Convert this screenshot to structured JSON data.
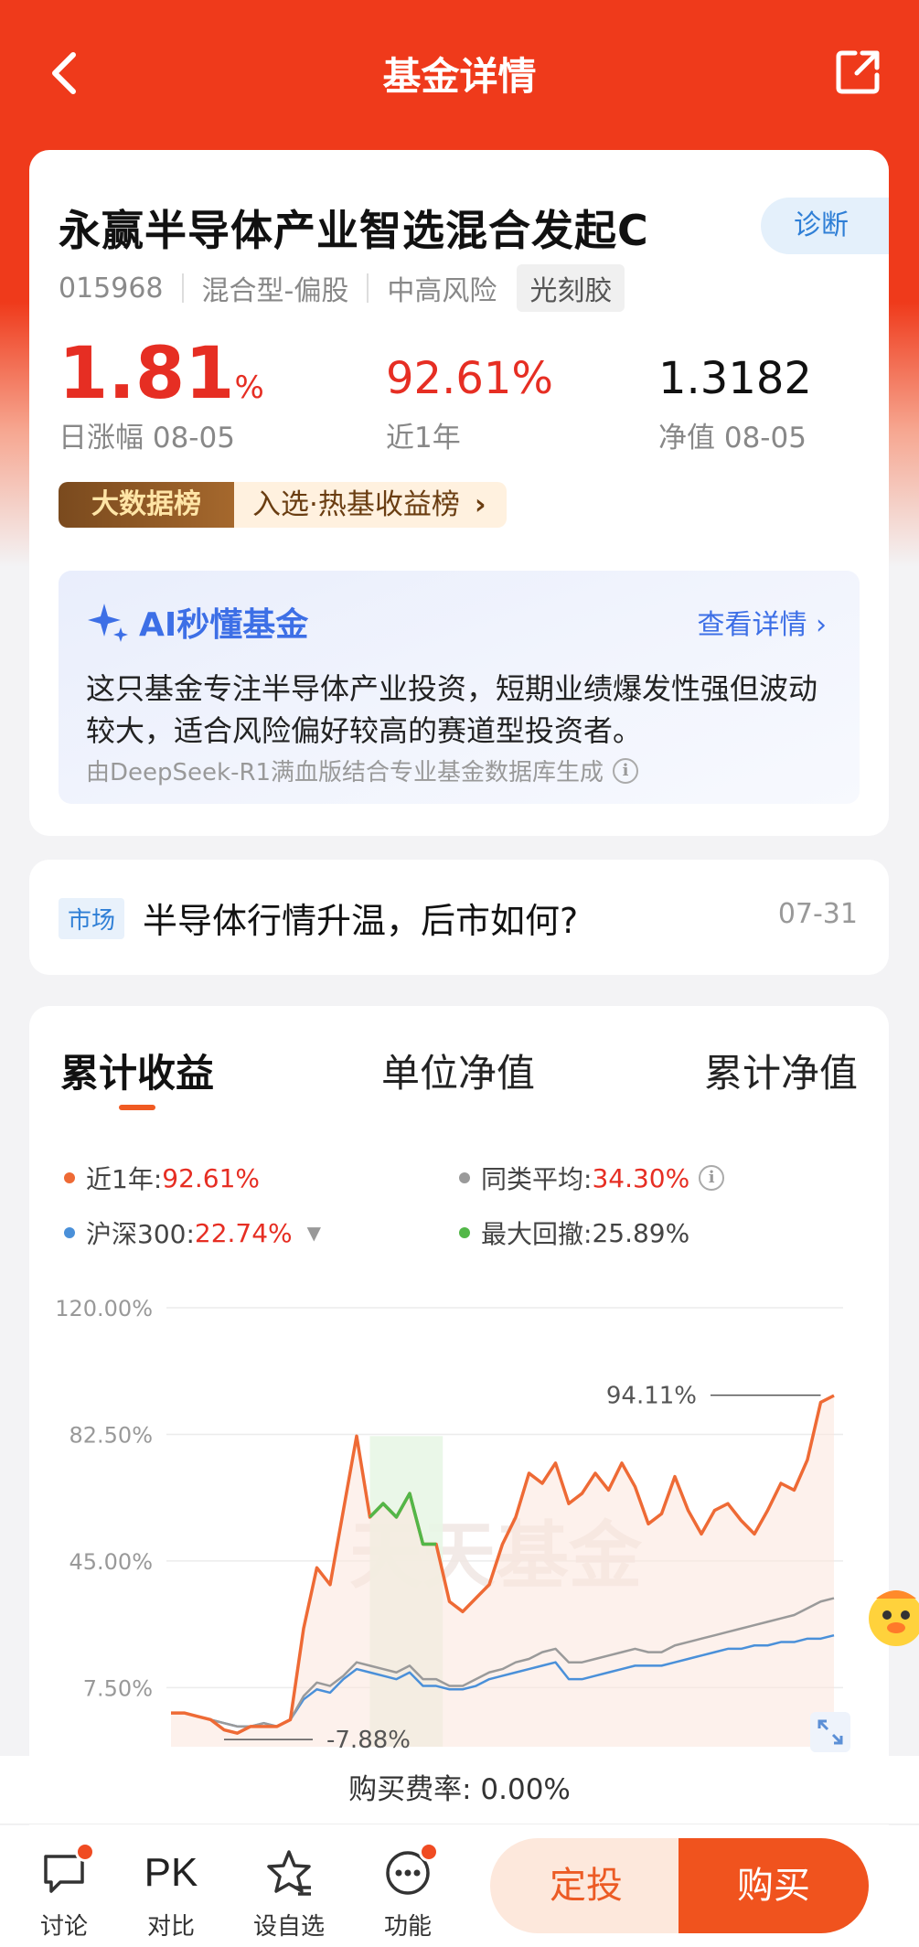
{
  "nav": {
    "title": "基金详情",
    "back_icon": "chevron-left-icon",
    "share_icon": "share-icon"
  },
  "fund": {
    "name": "永赢半导体产业智选混合发起C",
    "diagnose": "诊断",
    "code": "015968",
    "type": "混合型-偏股",
    "risk": "中高风险",
    "theme_tag": "光刻胶"
  },
  "stats": {
    "daily_value": "1.81",
    "daily_unit": "%",
    "daily_label": "日涨幅 08-05",
    "year_value": "92.61%",
    "year_label": "近1年",
    "nav_value": "1.3182",
    "nav_label": "净值 08-05"
  },
  "rank": {
    "badge": "大数据榜",
    "text": "入选·热基收益榜",
    "chevron": "›"
  },
  "ai": {
    "title": "AI秒懂基金",
    "more": "查看详情 ›",
    "desc": "这只基金专注半导体产业投资，短期业绩爆发性强但波动较大，适合风险偏好较高的赛道型投资者。",
    "footnote": "由DeepSeek-R1满血版结合专业基金数据库生成"
  },
  "news": {
    "tag": "市场",
    "title": "半导体行情升温，后市如何?",
    "date": "07-31"
  },
  "chart_tabs": {
    "tab1": "累计收益",
    "tab2": "单位净值",
    "tab3": "累计净值"
  },
  "legend": {
    "fund_label": "近1年:",
    "fund_value": "92.61%",
    "avg_label": "同类平均:",
    "avg_value": "34.30%",
    "index_label": "沪深300:",
    "index_value": "22.74%",
    "dd_label": "最大回撤:",
    "dd_value": "25.89%"
  },
  "colors": {
    "fund": "#ee6a35",
    "avg": "#9a9a9a",
    "index": "#4a90d9",
    "drawdown": "#52b748",
    "brand": "#ef3a1b"
  },
  "chart_data": {
    "type": "line",
    "ytick_labels": [
      "120.00%",
      "82.50%",
      "45.00%",
      "7.50%"
    ],
    "yticks": [
      120,
      82.5,
      45,
      7.5
    ],
    "ylim": [
      -7.88,
      120
    ],
    "watermark": "天天基金",
    "annotations": {
      "max_label": "94.11%",
      "max": 94.11,
      "min_label": "-7.88%",
      "min": -7.88
    },
    "x": [
      0,
      2,
      4,
      6,
      8,
      10,
      12,
      14,
      16,
      18,
      20,
      22,
      24,
      26,
      28,
      30,
      32,
      34,
      36,
      38,
      40,
      42,
      44,
      46,
      48,
      50,
      52,
      54,
      56,
      58,
      60,
      62,
      64,
      66,
      68,
      70,
      72,
      74,
      76,
      78,
      80,
      82,
      84,
      86,
      88,
      90,
      92,
      94,
      96,
      98,
      100
    ],
    "series": [
      {
        "name": "近1年",
        "values": [
          0,
          0,
          -1,
          -2,
          -5,
          -6,
          -4,
          -4,
          -4,
          -2,
          25,
          43,
          38,
          60,
          82,
          58,
          62,
          58,
          65,
          50,
          50,
          33,
          30,
          34,
          38,
          50,
          58,
          71,
          68,
          74,
          62,
          65,
          71,
          66,
          74,
          67,
          56,
          59,
          70,
          60,
          53,
          60,
          62,
          57,
          53,
          60,
          68,
          66,
          75,
          92,
          94
        ]
      },
      {
        "name": "同类平均",
        "values": [
          0,
          0,
          -1,
          -2,
          -3,
          -4,
          -4,
          -3,
          -4,
          -2,
          5,
          9,
          8,
          11,
          15,
          14,
          13,
          12,
          14,
          10,
          10,
          8,
          8,
          10,
          12,
          13,
          15,
          16,
          18,
          19,
          15,
          15,
          16,
          17,
          18,
          19,
          18,
          18,
          20,
          21,
          22,
          23,
          24,
          25,
          26,
          27,
          28,
          29,
          31,
          33,
          34
        ]
      },
      {
        "name": "沪深300",
        "values": [
          0,
          0,
          -1,
          -2,
          -3,
          -4,
          -4,
          -3,
          -4,
          -2,
          4,
          7,
          6,
          10,
          13,
          12,
          11,
          10,
          12,
          8,
          8,
          7,
          7,
          8,
          10,
          11,
          12,
          13,
          14,
          15,
          10,
          10,
          11,
          12,
          13,
          14,
          14,
          14,
          15,
          16,
          17,
          18,
          19,
          19,
          20,
          20,
          21,
          21,
          22,
          22,
          23
        ]
      }
    ],
    "drawdown_range": [
      30,
      41
    ]
  },
  "fee": "购买费率: 0.00%",
  "bottom": {
    "discuss": "讨论",
    "pk": "PK",
    "compare": "对比",
    "watchlist": "设自选",
    "features": "功能",
    "sip": "定投",
    "buy": "购买"
  }
}
